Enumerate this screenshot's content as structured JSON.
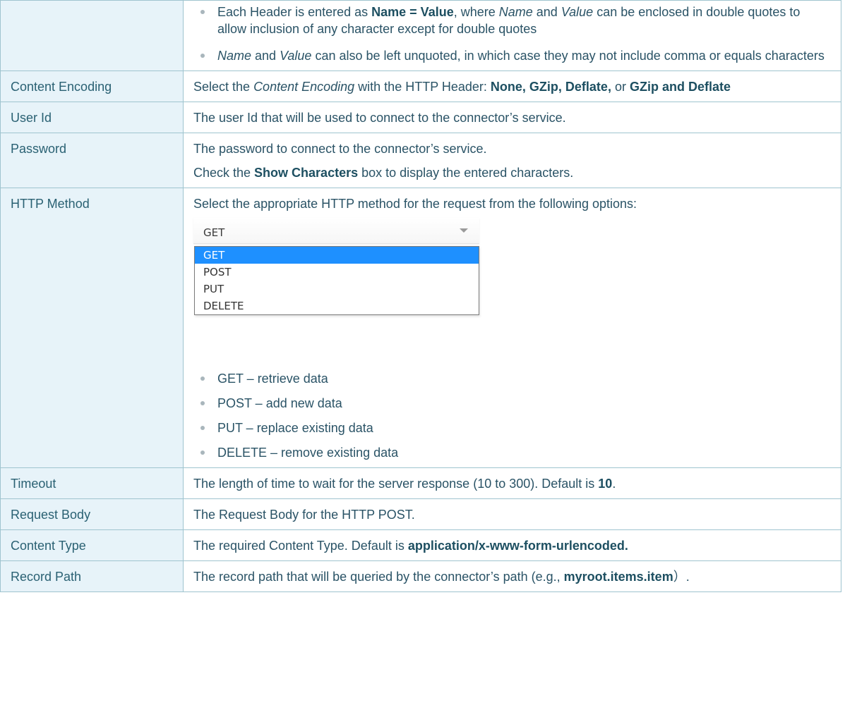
{
  "header_bullets": {
    "b1": {
      "t1": "Each Header is entered as ",
      "b1": "Name = Value",
      "t2": ", where ",
      "i1": "Name",
      "t3": " and ",
      "i2": "Value",
      "t4": " can be enclosed in double quotes to allow inclusion of any character except for double quotes"
    },
    "b2": {
      "i1": "Name",
      "t1": " and ",
      "i2": "Value",
      "t2": " can also be left unquoted, in which case they may not include comma or equals characters"
    }
  },
  "rows": {
    "content_encoding": {
      "name": "Content Encoding",
      "t1": "Select the ",
      "i1": "Content Encoding",
      "t2": " with the HTTP Header: ",
      "b1": "None, GZip, Deflate,",
      "t3": " or ",
      "b2": "GZip and Deflate"
    },
    "user_id": {
      "name": "User Id",
      "text": "The user Id that will be used to connect to the connector’s service."
    },
    "password": {
      "name": "Password",
      "line1": "The password to connect to the connector’s service.",
      "t1": "Check the ",
      "b1": "Show Characters",
      "t2": " box to display the entered characters."
    },
    "http_method": {
      "name": "HTTP Method",
      "intro": "Select the appropriate HTTP method for the request from the following options:",
      "dropdown": {
        "selected": "GET",
        "options": [
          "GET",
          "POST",
          "PUT",
          "DELETE"
        ],
        "highlight_color": "#1e90ff"
      },
      "bullets": [
        "GET – retrieve data",
        "POST – add new data",
        "PUT – replace existing data",
        "DELETE – remove existing data"
      ]
    },
    "timeout": {
      "name": "Timeout",
      "t1": "The length of time to wait for the server response (10 to 300). Default is ",
      "b1": "10",
      "t2": "."
    },
    "request_body": {
      "name": "Request Body",
      "text": "The Request Body for the HTTP POST."
    },
    "content_type": {
      "name": "Content Type",
      "t1": "The required Content Type. Default is ",
      "b1": "application/x-www-form-urlencoded."
    },
    "record_path": {
      "name": "Record Path",
      "t1": "The record path that will be queried by the connector’s path (e.g., ",
      "b1": "myroot.items.item",
      "t2": "）."
    }
  },
  "colors": {
    "name_cell_bg": "#e7f3f9",
    "border": "#9fc4cf",
    "text": "#2a5366"
  }
}
